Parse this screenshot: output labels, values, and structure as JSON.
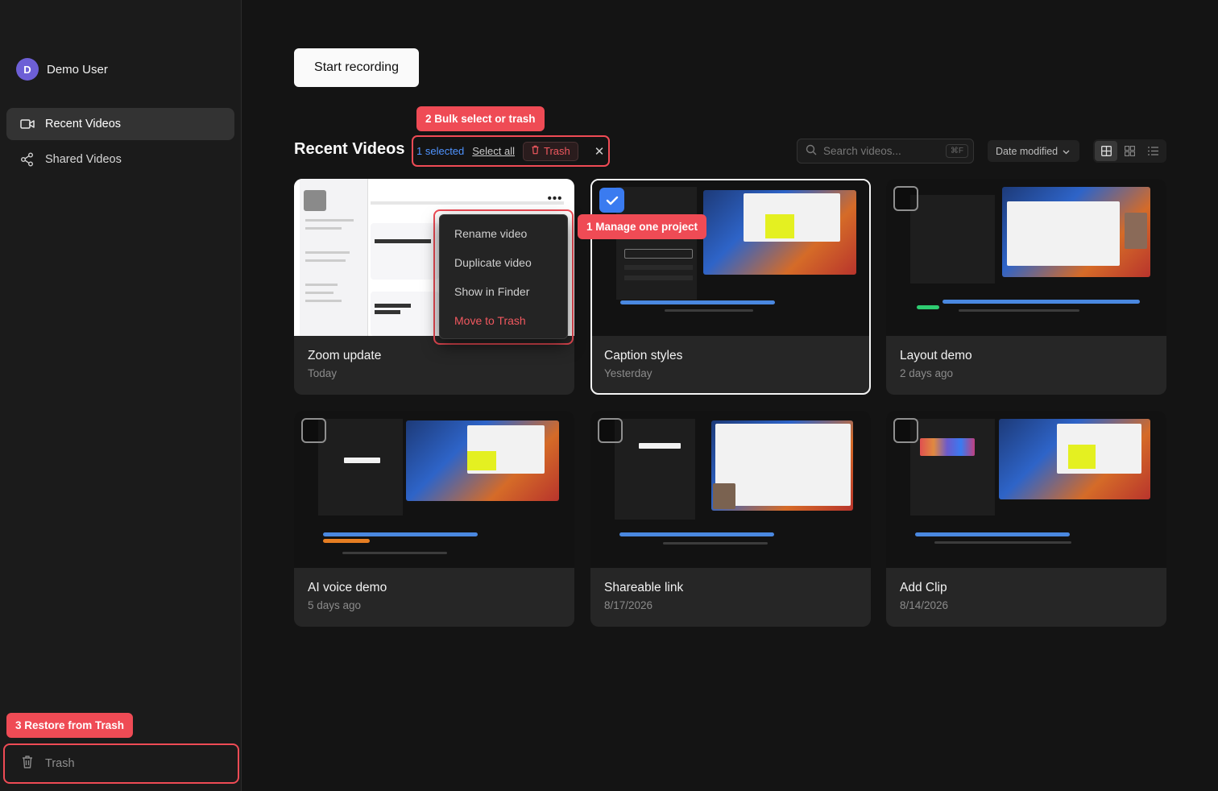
{
  "sidebar": {
    "user": {
      "initial": "D",
      "name": "Demo User"
    },
    "nav": [
      {
        "label": "Recent Videos",
        "icon": "video-icon",
        "active": true
      },
      {
        "label": "Shared Videos",
        "icon": "share-icon",
        "active": false
      }
    ],
    "trash_label": "Trash"
  },
  "callouts": {
    "manage": "1 Manage one project",
    "bulk": "2 Bulk select or trash",
    "restore": "3 Restore from Trash"
  },
  "main": {
    "start_button": "Start recording",
    "section_title": "Recent Videos",
    "bulk_bar": {
      "selected_text": "1 selected",
      "select_all": "Select all",
      "trash": "Trash"
    },
    "search": {
      "placeholder": "Search videos...",
      "shortcut": "⌘F"
    },
    "sort": {
      "selected": "Date modified"
    }
  },
  "context_menu": {
    "items": [
      "Rename video",
      "Duplicate video",
      "Show in Finder",
      "Move to Trash"
    ]
  },
  "videos": [
    {
      "title": "Zoom update",
      "date": "Today",
      "selected": false
    },
    {
      "title": "Caption styles",
      "date": "Yesterday",
      "selected": true
    },
    {
      "title": "Layout demo",
      "date": "2 days ago",
      "selected": false
    },
    {
      "title": "AI voice demo",
      "date": "5 days ago",
      "selected": false
    },
    {
      "title": "Shareable link",
      "date": "8/17/2026",
      "selected": false
    },
    {
      "title": "Add Clip",
      "date": "8/14/2026",
      "selected": false
    }
  ],
  "colors": {
    "accent_red": "#ef4b55",
    "selection_blue": "#3a7bf0",
    "background": "#141414",
    "sidebar": "#1b1b1b"
  }
}
